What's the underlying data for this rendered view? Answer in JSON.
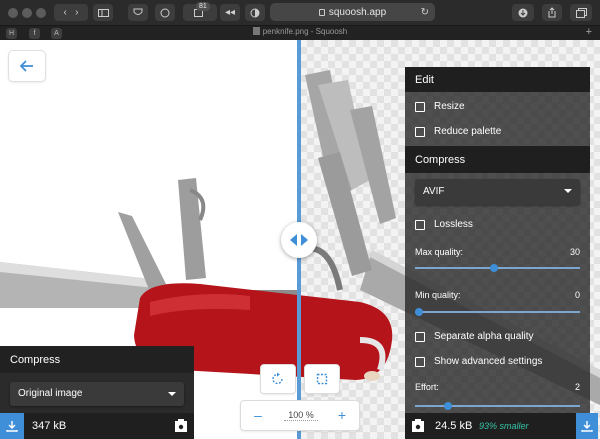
{
  "browser": {
    "url": "squoosh.app",
    "tab_title": "penknife.png - Squoosh",
    "badge_count": "81",
    "favicons": [
      "H",
      "A"
    ]
  },
  "app": {
    "zoom": {
      "value": "100",
      "unit": "%"
    },
    "left_panel": {
      "heading": "Compress",
      "encoder": "Original image",
      "size": "347 kB"
    },
    "right_panel": {
      "edit_heading": "Edit",
      "resize_label": "Resize",
      "reduce_palette_label": "Reduce palette",
      "compress_heading": "Compress",
      "encoder": "AVIF",
      "lossless_label": "Lossless",
      "max_quality_label": "Max quality:",
      "max_quality_value": "30",
      "min_quality_label": "Min quality:",
      "min_quality_value": "0",
      "separate_alpha_label": "Separate alpha quality",
      "show_advanced_label": "Show advanced settings",
      "effort_label": "Effort:",
      "effort_value": "2",
      "size": "24.5 kB",
      "savings": "93% smaller"
    },
    "slider_levels": {
      "max_quality_fraction": 0.48,
      "min_quality_fraction": 0.0,
      "effort_fraction": 0.2
    },
    "colors": {
      "accent": "#3e8fd8",
      "savings": "#36c6a8",
      "divider": "#5a9bd6"
    }
  }
}
